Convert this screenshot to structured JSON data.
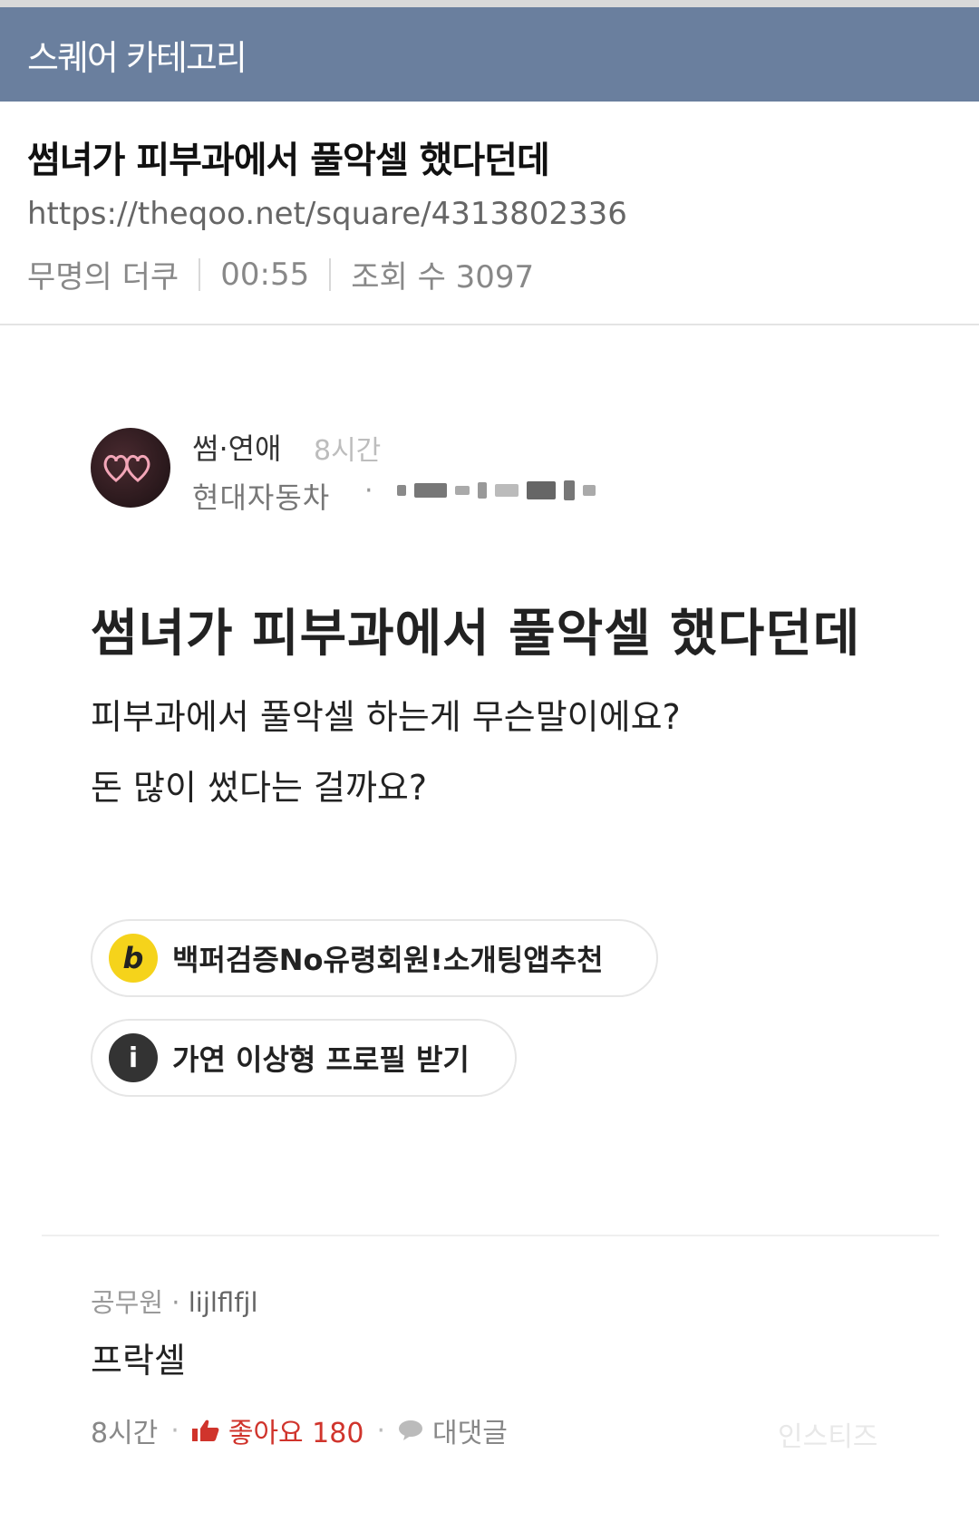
{
  "header": {
    "category_label": "스퀘어 카테고리",
    "title": "썸녀가 피부과에서 풀악셀 했다던데",
    "url": "https://theqoo.net/square/4313802336",
    "author": "무명의 더쿠",
    "time": "00:55",
    "views": "조회 수 3097"
  },
  "post": {
    "board": "썸·연애",
    "time_ago": "8시간",
    "company": "현대자동차",
    "dot": "·",
    "title": "썸녀가 피부과에서 풀악셀 했다던데",
    "body_lines": [
      "피부과에서 풀악셀 하는게 무슨말이에요?",
      "돈 많이 썼다는 걸까요?"
    ]
  },
  "ads": [
    {
      "icon_text": "b",
      "icon": "b-badge-icon",
      "label": "백퍼검증No유령회원!소개팅앱추천"
    },
    {
      "icon_text": "i",
      "icon": "info-icon",
      "label": "가연 이상형 프로필 받기"
    }
  ],
  "comment": {
    "author_job": "공무원",
    "sep": "·",
    "author_id": "lijlflfjl",
    "text": "프락셀",
    "time_ago": "8시간",
    "like_label": "좋아요 180",
    "reply_label": "대댓글",
    "watermark": "인스티즈"
  },
  "colors": {
    "category_bar": "#6a7f9e",
    "like_red": "#d0342c",
    "b_badge": "#f5d31b"
  }
}
